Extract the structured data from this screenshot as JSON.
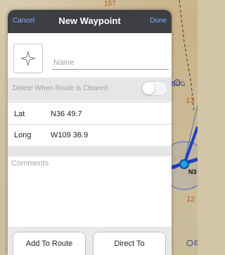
{
  "navbar": {
    "cancel_label": "Cancel",
    "title": "New Waypoint",
    "done_label": "Done"
  },
  "waypoint": {
    "icon": "star-outline-icon",
    "name_placeholder": "Name",
    "name_value": ""
  },
  "delete_toggle": {
    "label": "Delete When Route is Cleared",
    "enabled": false
  },
  "coordinates": [
    {
      "label": "Lat",
      "value": "N36 49.7"
    },
    {
      "label": "Long",
      "value": "W109 36.9"
    }
  ],
  "comments": {
    "placeholder": "Comments",
    "value": ""
  },
  "actions": {
    "add_to_route_label": "Add To Route",
    "direct_to_label": "Direct To"
  },
  "map": {
    "labels": {
      "top_num": "157",
      "bdg": "BDG",
      "num_13": "13",
      "n3": "N3",
      "num_12": "12",
      "bottom_e": "E"
    },
    "colors": {
      "route": "#1f3fc4",
      "labels": "#2b3a8a",
      "numbers": "#b85a1c"
    }
  }
}
